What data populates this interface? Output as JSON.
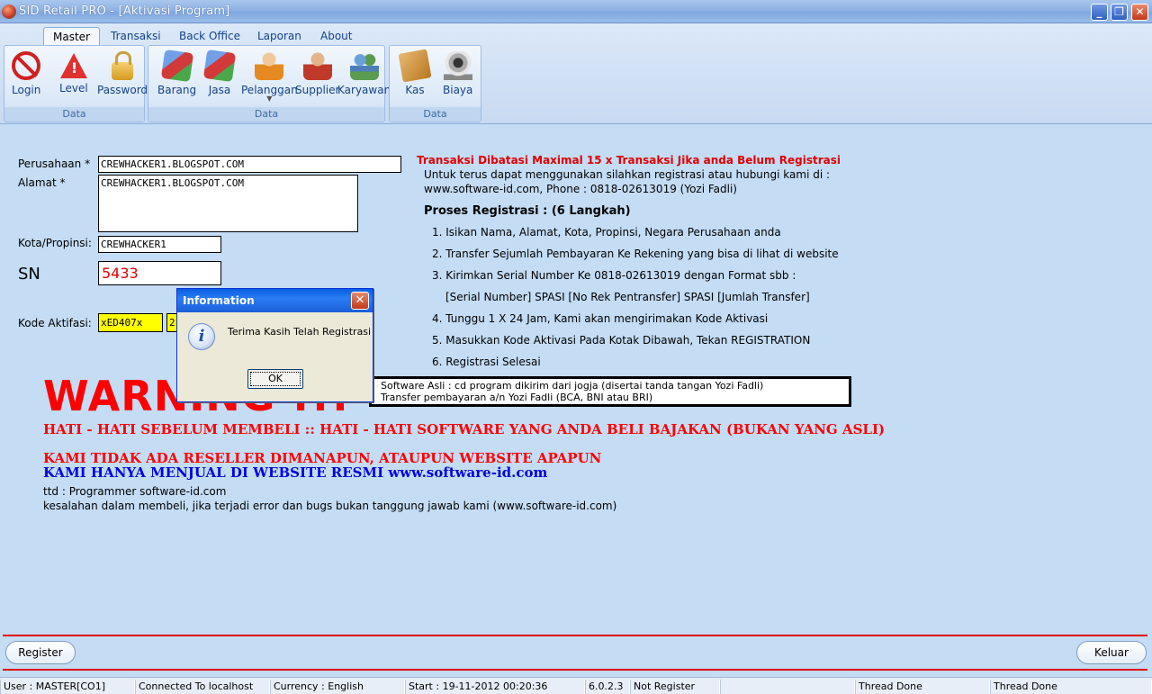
{
  "window": {
    "title": "SID Retail PRO - [Aktivasi Program]"
  },
  "ribbon": {
    "tabs": [
      "Master",
      "Transaksi",
      "Back Office",
      "Laporan",
      "About"
    ],
    "groups": [
      {
        "caption": "Data",
        "buttons": [
          {
            "label": "Login",
            "icon": "login-icon"
          },
          {
            "label": "Level",
            "icon": "warning-icon"
          },
          {
            "label": "Password",
            "icon": "lock-icon"
          }
        ]
      },
      {
        "caption": "Data",
        "buttons": [
          {
            "label": "Barang",
            "icon": "cube-icon"
          },
          {
            "label": "Jasa",
            "icon": "cube-icon"
          },
          {
            "label": "Pelanggan",
            "icon": "customer-icon"
          },
          {
            "label": "Supplier",
            "icon": "supplier-icon"
          },
          {
            "label": "Karyawan",
            "icon": "employees-icon"
          }
        ]
      },
      {
        "caption": "Data",
        "buttons": [
          {
            "label": "Kas",
            "icon": "cash-book-icon"
          },
          {
            "label": "Biaya",
            "icon": "webcam-icon"
          }
        ]
      }
    ]
  },
  "form": {
    "perusahaan_label": "Perusahaan *",
    "perusahaan_value": "CREWHACKER1.BLOGSPOT.COM",
    "alamat_label": "Alamat *",
    "alamat_value": "CREWHACKER1.BLOGSPOT.COM",
    "kota_label": "Kota/Propinsi:",
    "kota_value": "CREWHACKER1",
    "sn_label": "SN",
    "sn_value": "5433",
    "kode_label": "Kode Aktifasi:",
    "kode_value_1": "xED407x",
    "kode_value_2": "2"
  },
  "info": {
    "headline": "Transaksi Dibatasi Maximal 15 x Transaksi Jika anda Belum Registrasi",
    "line1": "Untuk terus dapat menggunakan silahkan registrasi atau hubungi kami di :",
    "line2": "www.software-id.com, Phone : 0818-02613019 (Yozi Fadli)",
    "proses": "Proses Registrasi : (6 Langkah)",
    "steps": [
      "1. Isikan Nama, Alamat, Kota, Propinsi, Negara Perusahaan anda",
      "2. Transfer Sejumlah Pembayaran Ke Rekening yang bisa di lihat di website",
      "3. Kirimkan Serial Number Ke 0818-02613019 dengan Format sbb :",
      "[Serial Number] SPASI [No Rek Pentransfer] SPASI [Jumlah Transfer]",
      "4. Tunggu 1 X 24 Jam, Kami akan mengirimakan Kode Aktivasi",
      "5. Masukkan Kode Aktivasi Pada Kotak Dibawah, Tekan REGISTRATION",
      "6. Registrasi Selesai"
    ]
  },
  "notice": {
    "line1": "Software Asli : cd program dikirim dari jogja (disertai tanda tangan Yozi Fadli)",
    "line2": "Transfer pembayaran a/n Yozi Fadli (BCA, BNI atau BRI)"
  },
  "warning": {
    "big": "WARNING !!!",
    "line1": "HATI - HATI SEBELUM MEMBELI :: HATI - HATI SOFTWARE YANG ANDA BELI BAJAKAN (BUKAN YANG ASLI)",
    "line2": "KAMI TIDAK ADA RESELLER DIMANAPUN, ATAUPUN WEBSITE APAPUN",
    "line3": "KAMI HANYA MENJUAL DI WEBSITE RESMI www.software-id.com",
    "ttd": "ttd : Programmer software-id.com",
    "disclaimer": "kesalahan dalam membeli, jika terjadi error dan bugs bukan tanggung jawab kami (www.software-id.com)"
  },
  "dialog": {
    "title": "Information",
    "message": "Terima Kasih Telah Registrasi",
    "ok": "OK"
  },
  "buttons": {
    "register": "Register",
    "keluar": "Keluar"
  },
  "status": {
    "user": "User : MASTER[CO1]",
    "connection": "Connected To localhost",
    "currency": "Currency : English",
    "start": "Start  : 19-11-2012 00:20:36",
    "version": "6.0.2.3",
    "registration": "Not Register",
    "empty": "",
    "thread1": "Thread Done",
    "thread2": "Thread Done"
  }
}
